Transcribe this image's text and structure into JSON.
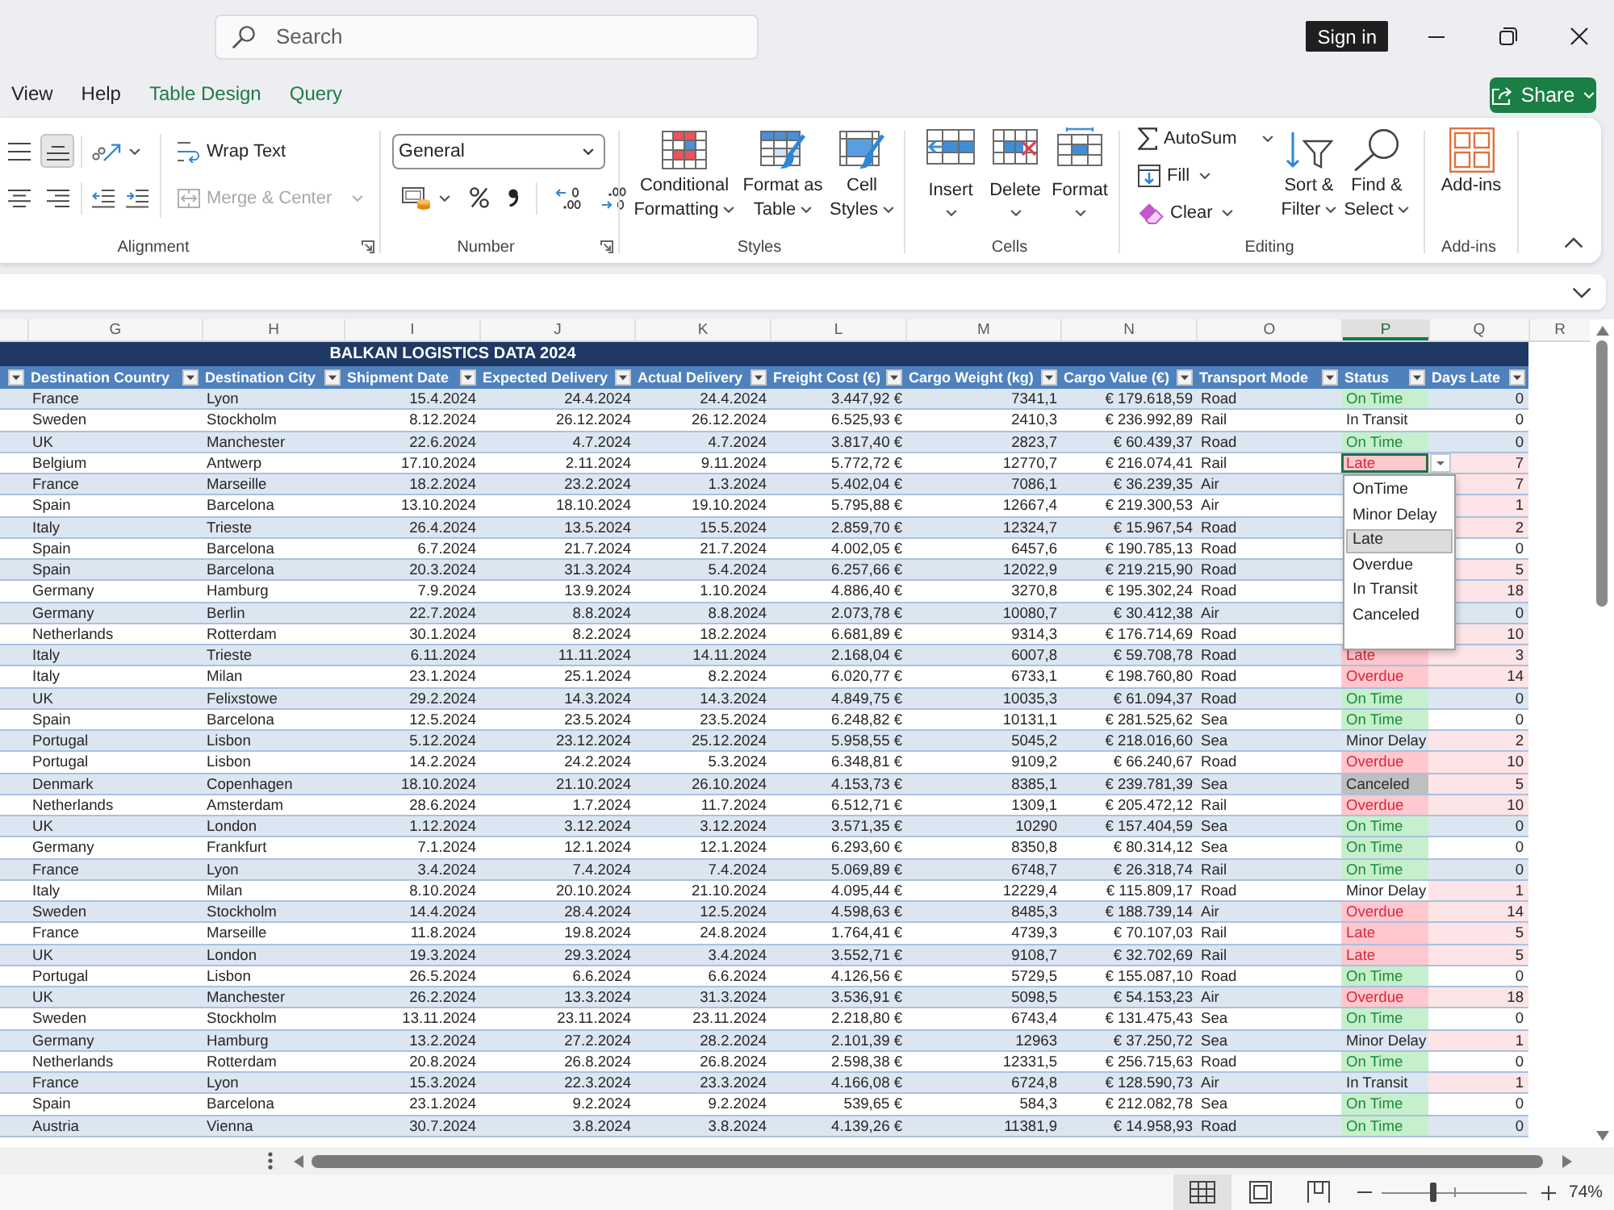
{
  "title_bar": {
    "search": {
      "placeholder": "Search"
    },
    "sign_in": "Sign in"
  },
  "menu": {
    "tabs": [
      {
        "label": "View",
        "kind": "standard",
        "selected": false
      },
      {
        "label": "Help",
        "kind": "standard",
        "selected": false
      },
      {
        "label": "Table Design",
        "kind": "contextual",
        "selected": false
      },
      {
        "label": "Query",
        "kind": "contextual",
        "selected": false
      }
    ],
    "share": "Share"
  },
  "ribbon": {
    "alignment": {
      "label": "Alignment",
      "align_buttons": [
        {
          "kind": "middle",
          "selected": false
        },
        {
          "kind": "bottom",
          "selected": true
        },
        {
          "kind": "center",
          "selected": false
        },
        {
          "kind": "right",
          "selected": false
        }
      ],
      "wrap_text": "Wrap Text",
      "merge": {
        "label": "Merge & Center",
        "disabled": true
      }
    },
    "number": {
      "label": "Number",
      "format": "General"
    },
    "styles": {
      "label": "Styles",
      "buttons": [
        {
          "kind": "conditional",
          "lines": [
            "Conditional",
            "Formatting"
          ]
        },
        {
          "kind": "table",
          "lines": [
            "Format as",
            "Table"
          ]
        },
        {
          "kind": "cell_styles",
          "lines": [
            "Cell",
            "Styles"
          ]
        }
      ]
    },
    "cells": {
      "label": "Cells",
      "buttons": [
        {
          "kind": "insert",
          "label": "Insert"
        },
        {
          "kind": "delete",
          "label": "Delete"
        },
        {
          "kind": "format",
          "label": "Format"
        }
      ]
    },
    "editing": {
      "label": "Editing",
      "small_buttons": [
        {
          "kind": "autosum",
          "label": "AutoSum"
        },
        {
          "kind": "fill",
          "label": "Fill"
        },
        {
          "kind": "clear",
          "label": "Clear"
        }
      ],
      "large_buttons": [
        {
          "kind": "sort",
          "lines": [
            "Sort &",
            "Filter"
          ]
        },
        {
          "kind": "find",
          "lines": [
            "Find &",
            "Select"
          ]
        }
      ]
    },
    "addins": {
      "label": "Add-ins",
      "button": "Add-ins"
    }
  },
  "sheet": {
    "columns": [
      {
        "letter": "G",
        "selected": false
      },
      {
        "letter": "H",
        "selected": false
      },
      {
        "letter": "I",
        "selected": false
      },
      {
        "letter": "J",
        "selected": false
      },
      {
        "letter": "K",
        "selected": false
      },
      {
        "letter": "L",
        "selected": false
      },
      {
        "letter": "M",
        "selected": false
      },
      {
        "letter": "N",
        "selected": false
      },
      {
        "letter": "O",
        "selected": false
      },
      {
        "letter": "P",
        "selected": true
      },
      {
        "letter": "Q",
        "selected": false
      },
      {
        "letter": "R",
        "selected": false
      }
    ],
    "table": {
      "title": "BALKAN LOGISTICS DATA 2024",
      "headers": [
        "Destination Country",
        "Destination City",
        "Shipment Date",
        "Expected Delivery",
        "Actual Delivery",
        "Freight Cost (€)",
        "Cargo Weight (kg)",
        "Cargo Value (€)",
        "Transport Mode",
        "Status",
        "Days Late"
      ],
      "rows": [
        {
          "cells": [
            "France",
            "Lyon",
            "15.4.2024",
            "24.4.2024",
            "24.4.2024",
            "3.447,92 €",
            "7341,1",
            "€ 179.618,59",
            "Road"
          ],
          "status": {
            "label": "On Time",
            "kind": "on_time"
          },
          "days_late": "0",
          "days_flagged": false,
          "selected": false
        },
        {
          "cells": [
            "Sweden",
            "Stockholm",
            "8.12.2024",
            "26.12.2024",
            "26.12.2024",
            "6.525,93 €",
            "2410,3",
            "€ 236.992,89",
            "Rail"
          ],
          "status": {
            "label": "In Transit",
            "kind": "in_transit"
          },
          "days_late": "0",
          "days_flagged": false,
          "selected": false
        },
        {
          "cells": [
            "UK",
            "Manchester",
            "22.6.2024",
            "4.7.2024",
            "4.7.2024",
            "3.817,40 €",
            "2823,7",
            "€ 60.439,37",
            "Road"
          ],
          "status": {
            "label": "On Time",
            "kind": "on_time"
          },
          "days_late": "0",
          "days_flagged": false,
          "selected": false
        },
        {
          "cells": [
            "Belgium",
            "Antwerp",
            "17.10.2024",
            "2.11.2024",
            "9.11.2024",
            "5.772,72 €",
            "12770,7",
            "€ 216.074,41",
            "Rail"
          ],
          "status": {
            "label": "Late",
            "kind": "late"
          },
          "days_late": "7",
          "days_flagged": true,
          "selected": true
        },
        {
          "cells": [
            "France",
            "Marseille",
            "18.2.2024",
            "23.2.2024",
            "1.3.2024",
            "5.402,04 €",
            "7086,1",
            "€ 36.239,35",
            "Air"
          ],
          "days_late": "7",
          "days_flagged": true,
          "selected": false
        },
        {
          "cells": [
            "Spain",
            "Barcelona",
            "13.10.2024",
            "18.10.2024",
            "19.10.2024",
            "5.795,88 €",
            "12667,4",
            "€ 219.300,53",
            "Air"
          ],
          "days_late": "1",
          "days_flagged": true,
          "selected": false
        },
        {
          "cells": [
            "Italy",
            "Trieste",
            "26.4.2024",
            "13.5.2024",
            "15.5.2024",
            "2.859,70 €",
            "12324,7",
            "€ 15.967,54",
            "Road"
          ],
          "days_late": "2",
          "days_flagged": true,
          "selected": false
        },
        {
          "cells": [
            "Spain",
            "Barcelona",
            "6.7.2024",
            "21.7.2024",
            "21.7.2024",
            "4.002,05 €",
            "6457,6",
            "€ 190.785,13",
            "Road"
          ],
          "days_late": "0",
          "days_flagged": false,
          "selected": false
        },
        {
          "cells": [
            "Spain",
            "Barcelona",
            "20.3.2024",
            "31.3.2024",
            "5.4.2024",
            "6.257,66 €",
            "12022,9",
            "€ 219.215,90",
            "Road"
          ],
          "days_late": "5",
          "days_flagged": true,
          "selected": false
        },
        {
          "cells": [
            "Germany",
            "Hamburg",
            "7.9.2024",
            "13.9.2024",
            "1.10.2024",
            "4.886,40 €",
            "3270,8",
            "€ 195.302,24",
            "Road"
          ],
          "days_late": "18",
          "days_flagged": true,
          "selected": false
        },
        {
          "cells": [
            "Germany",
            "Berlin",
            "22.7.2024",
            "8.8.2024",
            "8.8.2024",
            "2.073,78 €",
            "10080,7",
            "€ 30.412,38",
            "Air"
          ],
          "days_late": "0",
          "days_flagged": false,
          "selected": false
        },
        {
          "cells": [
            "Netherlands",
            "Rotterdam",
            "30.1.2024",
            "8.2.2024",
            "18.2.2024",
            "6.681,89 €",
            "9314,3",
            "€ 176.714,69",
            "Road"
          ],
          "days_late": "10",
          "days_flagged": true,
          "selected": false
        },
        {
          "cells": [
            "Italy",
            "Trieste",
            "6.11.2024",
            "11.11.2024",
            "14.11.2024",
            "2.168,04 €",
            "6007,8",
            "€ 59.708,78",
            "Road"
          ],
          "status": {
            "label": "Late",
            "kind": "late"
          },
          "days_late": "3",
          "days_flagged": true,
          "selected": false
        },
        {
          "cells": [
            "Italy",
            "Milan",
            "23.1.2024",
            "25.1.2024",
            "8.2.2024",
            "6.020,77 €",
            "6733,1",
            "€ 198.760,80",
            "Road"
          ],
          "status": {
            "label": "Overdue",
            "kind": "overdue"
          },
          "days_late": "14",
          "days_flagged": true,
          "selected": false
        },
        {
          "cells": [
            "UK",
            "Felixstowe",
            "29.2.2024",
            "14.3.2024",
            "14.3.2024",
            "4.849,75 €",
            "10035,3",
            "€ 61.094,37",
            "Road"
          ],
          "status": {
            "label": "On Time",
            "kind": "on_time"
          },
          "days_late": "0",
          "days_flagged": false,
          "selected": false
        },
        {
          "cells": [
            "Spain",
            "Barcelona",
            "12.5.2024",
            "23.5.2024",
            "23.5.2024",
            "6.248,82 €",
            "10131,1",
            "€ 281.525,62",
            "Sea"
          ],
          "status": {
            "label": "On Time",
            "kind": "on_time"
          },
          "days_late": "0",
          "days_flagged": false,
          "selected": false
        },
        {
          "cells": [
            "Portugal",
            "Lisbon",
            "5.12.2024",
            "23.12.2024",
            "25.12.2024",
            "5.958,55 €",
            "5045,2",
            "€ 218.016,60",
            "Sea"
          ],
          "status": {
            "label": "Minor Delay",
            "kind": "minor_delay"
          },
          "days_late": "2",
          "days_flagged": true,
          "selected": false
        },
        {
          "cells": [
            "Portugal",
            "Lisbon",
            "14.2.2024",
            "24.2.2024",
            "5.3.2024",
            "6.348,81 €",
            "9109,2",
            "€ 66.240,67",
            "Road"
          ],
          "status": {
            "label": "Overdue",
            "kind": "overdue"
          },
          "days_late": "10",
          "days_flagged": true,
          "selected": false
        },
        {
          "cells": [
            "Denmark",
            "Copenhagen",
            "18.10.2024",
            "21.10.2024",
            "26.10.2024",
            "4.153,73 €",
            "8385,1",
            "€ 239.781,39",
            "Sea"
          ],
          "status": {
            "label": "Canceled",
            "kind": "canceled"
          },
          "days_late": "5",
          "days_flagged": true,
          "selected": false
        },
        {
          "cells": [
            "Netherlands",
            "Amsterdam",
            "28.6.2024",
            "1.7.2024",
            "11.7.2024",
            "6.512,71 €",
            "1309,1",
            "€ 205.472,12",
            "Rail"
          ],
          "status": {
            "label": "Overdue",
            "kind": "overdue"
          },
          "days_late": "10",
          "days_flagged": true,
          "selected": false
        },
        {
          "cells": [
            "UK",
            "London",
            "1.12.2024",
            "3.12.2024",
            "3.12.2024",
            "3.571,35 €",
            "10290",
            "€ 157.404,59",
            "Sea"
          ],
          "status": {
            "label": "On Time",
            "kind": "on_time"
          },
          "days_late": "0",
          "days_flagged": false,
          "selected": false
        },
        {
          "cells": [
            "Germany",
            "Frankfurt",
            "7.1.2024",
            "12.1.2024",
            "12.1.2024",
            "6.293,60 €",
            "8350,8",
            "€ 80.314,12",
            "Sea"
          ],
          "status": {
            "label": "On Time",
            "kind": "on_time"
          },
          "days_late": "0",
          "days_flagged": false,
          "selected": false
        },
        {
          "cells": [
            "France",
            "Lyon",
            "3.4.2024",
            "7.4.2024",
            "7.4.2024",
            "5.069,89 €",
            "6748,7",
            "€ 26.318,74",
            "Rail"
          ],
          "status": {
            "label": "On Time",
            "kind": "on_time"
          },
          "days_late": "0",
          "days_flagged": false,
          "selected": false
        },
        {
          "cells": [
            "Italy",
            "Milan",
            "8.10.2024",
            "20.10.2024",
            "21.10.2024",
            "4.095,44 €",
            "12229,4",
            "€ 115.809,17",
            "Road"
          ],
          "status": {
            "label": "Minor Delay",
            "kind": "minor_delay"
          },
          "days_late": "1",
          "days_flagged": true,
          "selected": false
        },
        {
          "cells": [
            "Sweden",
            "Stockholm",
            "14.4.2024",
            "28.4.2024",
            "12.5.2024",
            "4.598,63 €",
            "8485,3",
            "€ 188.739,14",
            "Air"
          ],
          "status": {
            "label": "Overdue",
            "kind": "overdue"
          },
          "days_late": "14",
          "days_flagged": true,
          "selected": false
        },
        {
          "cells": [
            "France",
            "Marseille",
            "11.8.2024",
            "19.8.2024",
            "24.8.2024",
            "1.764,41 €",
            "4739,3",
            "€ 70.107,03",
            "Rail"
          ],
          "status": {
            "label": "Late",
            "kind": "late"
          },
          "days_late": "5",
          "days_flagged": true,
          "selected": false
        },
        {
          "cells": [
            "UK",
            "London",
            "19.3.2024",
            "29.3.2024",
            "3.4.2024",
            "3.552,71 €",
            "9108,7",
            "€ 32.702,69",
            "Rail"
          ],
          "status": {
            "label": "Late",
            "kind": "late"
          },
          "days_late": "5",
          "days_flagged": true,
          "selected": false
        },
        {
          "cells": [
            "Portugal",
            "Lisbon",
            "26.5.2024",
            "6.6.2024",
            "6.6.2024",
            "4.126,56 €",
            "5729,5",
            "€ 155.087,10",
            "Road"
          ],
          "status": {
            "label": "On Time",
            "kind": "on_time"
          },
          "days_late": "0",
          "days_flagged": false,
          "selected": false
        },
        {
          "cells": [
            "UK",
            "Manchester",
            "26.2.2024",
            "13.3.2024",
            "31.3.2024",
            "3.536,91 €",
            "5098,5",
            "€ 54.153,23",
            "Air"
          ],
          "status": {
            "label": "Overdue",
            "kind": "overdue"
          },
          "days_late": "18",
          "days_flagged": true,
          "selected": false
        },
        {
          "cells": [
            "Sweden",
            "Stockholm",
            "13.11.2024",
            "23.11.2024",
            "23.11.2024",
            "2.218,80 €",
            "6743,4",
            "€ 131.475,43",
            "Sea"
          ],
          "status": {
            "label": "On Time",
            "kind": "on_time"
          },
          "days_late": "0",
          "days_flagged": false,
          "selected": false
        },
        {
          "cells": [
            "Germany",
            "Hamburg",
            "13.2.2024",
            "27.2.2024",
            "28.2.2024",
            "2.101,39 €",
            "12963",
            "€ 37.250,72",
            "Sea"
          ],
          "status": {
            "label": "Minor Delay",
            "kind": "minor_delay"
          },
          "days_late": "1",
          "days_flagged": true,
          "selected": false
        },
        {
          "cells": [
            "Netherlands",
            "Rotterdam",
            "20.8.2024",
            "26.8.2024",
            "26.8.2024",
            "2.598,38 €",
            "12331,5",
            "€ 256.715,63",
            "Road"
          ],
          "status": {
            "label": "On Time",
            "kind": "on_time"
          },
          "days_late": "0",
          "days_flagged": false,
          "selected": false
        },
        {
          "cells": [
            "France",
            "Lyon",
            "15.3.2024",
            "22.3.2024",
            "23.3.2024",
            "4.166,08 €",
            "6724,8",
            "€ 128.590,73",
            "Air"
          ],
          "status": {
            "label": "In Transit",
            "kind": "in_transit"
          },
          "days_late": "1",
          "days_flagged": true,
          "selected": false
        },
        {
          "cells": [
            "Spain",
            "Barcelona",
            "23.1.2024",
            "9.2.2024",
            "9.2.2024",
            "539,65 €",
            "584,3",
            "€ 212.082,78",
            "Sea"
          ],
          "status": {
            "label": "On Time",
            "kind": "on_time"
          },
          "days_late": "0",
          "days_flagged": false,
          "selected": false
        },
        {
          "cells": [
            "Austria",
            "Vienna",
            "30.7.2024",
            "3.8.2024",
            "3.8.2024",
            "4.139,26 €",
            "11381,9",
            "€ 14.958,93",
            "Road"
          ],
          "status": {
            "label": "On Time",
            "kind": "on_time"
          },
          "days_late": "0",
          "days_flagged": false,
          "selected": false
        }
      ],
      "status_dropdown": {
        "options": [
          {
            "label": "OnTime",
            "selected": false
          },
          {
            "label": "Minor Delay",
            "selected": false
          },
          {
            "label": "Late",
            "selected": true
          },
          {
            "label": "Overdue",
            "selected": false
          },
          {
            "label": "In Transit",
            "selected": false
          },
          {
            "label": "Canceled",
            "selected": false
          }
        ]
      }
    }
  },
  "status_bar": {
    "views": [
      {
        "kind": "normal",
        "selected": true
      },
      {
        "kind": "page_layout",
        "selected": false
      },
      {
        "kind": "page_break",
        "selected": false
      }
    ],
    "zoom": {
      "level": 0.36,
      "reading": "74%"
    }
  }
}
